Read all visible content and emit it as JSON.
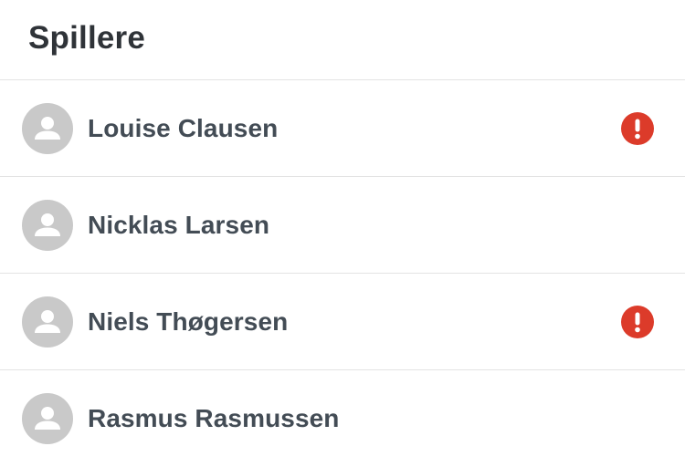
{
  "header": {
    "title": "Spillere"
  },
  "players": [
    {
      "name": "Louise Clausen",
      "avatar_icon": "user-silhouette-icon",
      "has_alert": true
    },
    {
      "name": "Nicklas Larsen",
      "avatar_icon": "user-silhouette-icon",
      "has_alert": false
    },
    {
      "name": "Niels Thøgersen",
      "avatar_icon": "user-silhouette-icon",
      "has_alert": true
    },
    {
      "name": "Rasmus Rasmussen",
      "avatar_icon": "user-silhouette-icon",
      "has_alert": false
    }
  ],
  "colors": {
    "alert": "#dc3b2a",
    "avatar_bg": "#c9c9c9",
    "divider": "#e3e3e3",
    "name_text": "#434c55",
    "title_text": "#2f3338"
  }
}
